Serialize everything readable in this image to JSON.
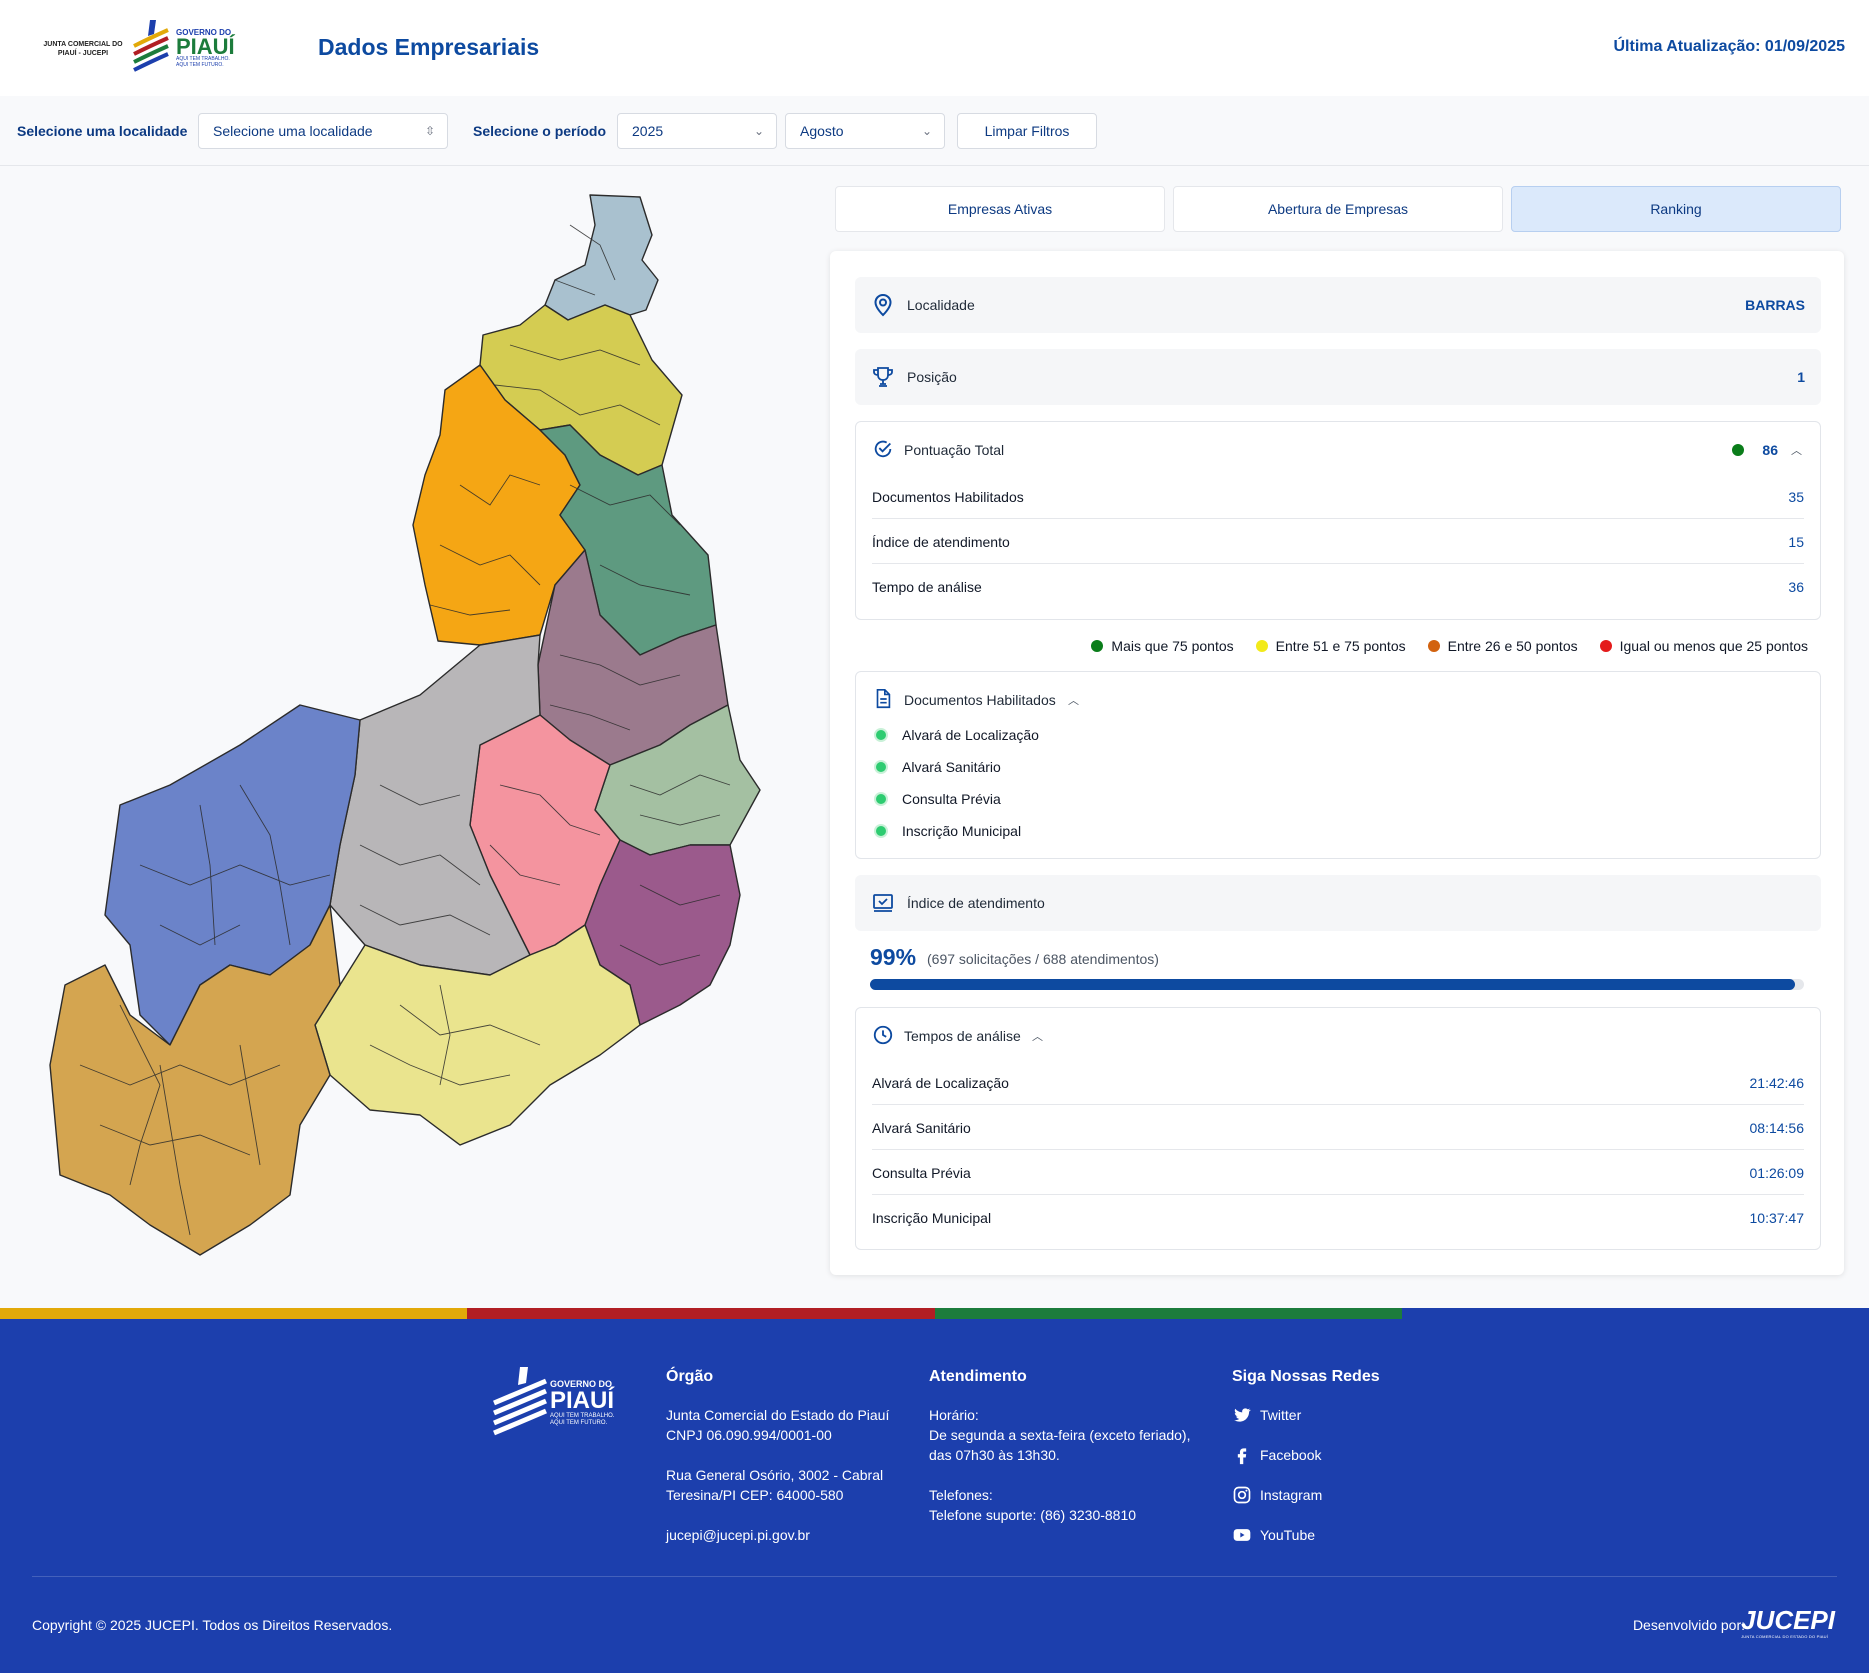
{
  "header": {
    "logo_left_text": "JUNTA COMERCIAL DO PIAUÍ - JUCEPI",
    "logo_gov_small": "GOVERNO DO",
    "logo_gov_big": "PIAUÍ",
    "logo_gov_tagline1": "AQUI TEM TRABALHO.",
    "logo_gov_tagline2": "AQUI TEM FUTURO.",
    "title": "Dados Empresariais",
    "last_update": "Última Atualização: 01/09/2025"
  },
  "filters": {
    "location_label": "Selecione uma localidade",
    "location_value": "Selecione uma localidade",
    "period_label": "Selecione o período",
    "year_value": "2025",
    "month_value": "Agosto",
    "clear_label": "Limpar Filtros"
  },
  "tabs": [
    {
      "label": "Empresas Ativas",
      "active": false
    },
    {
      "label": "Abertura de Empresas",
      "active": false
    },
    {
      "label": "Ranking",
      "active": true
    }
  ],
  "ranking": {
    "locality_label": "Localidade",
    "locality_value": "BARRAS",
    "position_label": "Posição",
    "position_value": "1",
    "score": {
      "title": "Pontuação Total",
      "total": "86",
      "status_color": "#0a7d1a",
      "items": [
        {
          "label": "Documentos Habilitados",
          "value": "35"
        },
        {
          "label": "Índice de atendimento",
          "value": "15"
        },
        {
          "label": "Tempo de análise",
          "value": "36"
        }
      ]
    },
    "legend": [
      {
        "label": "Mais que 75 pontos",
        "color": "#0a7d1a"
      },
      {
        "label": "Entre 51 e 75 pontos",
        "color": "#f2ea1a"
      },
      {
        "label": "Entre 26 e 50 pontos",
        "color": "#d2620f"
      },
      {
        "label": "Igual ou menos que 25 pontos",
        "color": "#e41b1b"
      }
    ],
    "documents": {
      "title": "Documentos Habilitados",
      "items": [
        "Alvará de Localização",
        "Alvará Sanitário",
        "Consulta Prévia",
        "Inscrição Municipal"
      ]
    },
    "service_index": {
      "title": "Índice de atendimento",
      "percent_label": "99%",
      "percent_value": 0.99,
      "detail": "(697 solicitações / 688 atendimentos)"
    },
    "analysis_times": {
      "title": "Tempos de análise",
      "items": [
        {
          "label": "Alvará de Localização",
          "value": "21:42:46"
        },
        {
          "label": "Alvará Sanitário",
          "value": "08:14:56"
        },
        {
          "label": "Consulta Prévia",
          "value": "01:26:09"
        },
        {
          "label": "Inscrição Municipal",
          "value": "10:37:47"
        }
      ]
    }
  },
  "map": {
    "region_colors": [
      "#a9c1cf",
      "#d4cc52",
      "#f5a614",
      "#5e9a80",
      "#9b7a8d",
      "#a4c0a2",
      "#f4949f",
      "#b8b6b8",
      "#9b5a8c",
      "#6b83c9",
      "#eae48e",
      "#d4a550"
    ]
  },
  "footer": {
    "stripe_colors": [
      "#e2a909",
      "#b11e24",
      "#1c7c3c",
      "#1c3fad"
    ],
    "logo_small": "GOVERNO DO",
    "logo_big": "PIAUÍ",
    "logo_tag1": "AQUI TEM TRABALHO.",
    "logo_tag2": "AQUI TEM FUTURO.",
    "org": {
      "title": "Órgão",
      "name": "Junta Comercial do Estado do Piauí",
      "cnpj": "CNPJ 06.090.994/0001-00",
      "address1": "Rua General Osório, 3002 - Cabral",
      "address2": "Teresina/PI CEP: 64000-580",
      "email": "jucepi@jucepi.pi.gov.br"
    },
    "service": {
      "title": "Atendimento",
      "hours_label": "Horário:",
      "hours1": "De segunda a sexta-feira (exceto feriado),",
      "hours2": "das 07h30 às 13h30.",
      "phones_label": "Telefones:",
      "phone": "Telefone suporte: (86) 3230-8810"
    },
    "social": {
      "title": "Siga Nossas Redes",
      "items": [
        {
          "label": "Twitter",
          "icon": "twitter-icon"
        },
        {
          "label": "Facebook",
          "icon": "facebook-icon"
        },
        {
          "label": "Instagram",
          "icon": "instagram-icon"
        },
        {
          "label": "YouTube",
          "icon": "youtube-icon"
        }
      ]
    },
    "copyright": "Copyright © 2025 JUCEPI. Todos os Direitos Reservados.",
    "developed_by": "Desenvolvido por:",
    "dev_logo": "JUCEPI",
    "dev_logo_sub": "JUNTA COMERCIAL DO ESTADO DO PIAUÍ"
  }
}
